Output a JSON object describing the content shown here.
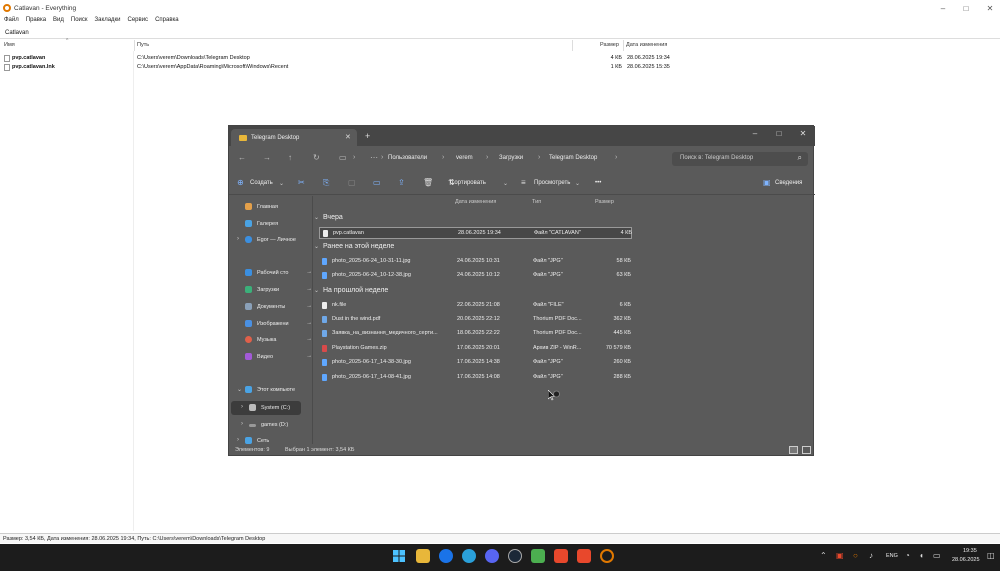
{
  "everything": {
    "title": "Catlavan - Everything",
    "menu": [
      "Файл",
      "Правка",
      "Вид",
      "Поиск",
      "Закладки",
      "Сервис",
      "Справка"
    ],
    "search_value": "Catlavan",
    "columns": {
      "name": "Имя",
      "path": "Путь",
      "size": "Размер",
      "date": "Дата изменения"
    },
    "results": [
      {
        "name": "pvp.catlavan",
        "path": "C:\\Users\\verem\\Downloads\\Telegram Desktop",
        "size": "4 КБ",
        "date": "28.06.2025 19:34"
      },
      {
        "name": "pvp.catlavan.lnk",
        "path": "C:\\Users\\verem\\AppData\\Roaming\\Microsoft\\Windows\\Recent",
        "size": "1 КБ",
        "date": "28.06.2025 15:35"
      }
    ],
    "status": "Размер: 3,54 КБ, Дата изменения: 28.06.2025 19:34, Путь: C:\\Users\\verem\\Downloads\\Telegram Desktop"
  },
  "explorer": {
    "tab_title": "Telegram Desktop",
    "breadcrumb": [
      "Пользователи",
      "verem",
      "Загрузки",
      "Telegram Desktop"
    ],
    "search_placeholder": "Поиск в: Telegram Desktop",
    "toolbar": {
      "create": "Создать",
      "sort": "Сортировать",
      "view": "Просмотреть",
      "details": "Сведения"
    },
    "nav": {
      "home": "Главная",
      "gallery": "Галерея",
      "egor": "Egor — Личное",
      "desktop": "Рабочий сто",
      "downloads": "Загрузки",
      "documents": "Документы",
      "images": "Изображени",
      "music": "Музыка",
      "video": "Видео",
      "this_pc": "Этот компьюте",
      "system": "System (C:)",
      "games": "games (D:)",
      "network": "Сеть"
    },
    "columns": {
      "date": "Дата изменения",
      "type": "Тип",
      "size": "Размер"
    },
    "groups": {
      "today": "Вчера",
      "earlier_week": "Ранее на этой неделе",
      "last_week": "На прошлой неделе"
    },
    "files_today": [
      {
        "name": "pvp.catlavan",
        "date": "28.06.2025 19:34",
        "type": "Файл \"CATLAVAN\"",
        "size": "4 КБ"
      }
    ],
    "files_week": [
      {
        "name": "photo_2025-06-24_10-31-11.jpg",
        "date": "24.06.2025 10:31",
        "type": "Файл \"JPG\"",
        "size": "58 КБ"
      },
      {
        "name": "photo_2025-06-24_10-12-38.jpg",
        "date": "24.06.2025 10:12",
        "type": "Файл \"JPG\"",
        "size": "63 КБ"
      }
    ],
    "files_last": [
      {
        "name": "nk.file",
        "date": "22.06.2025 21:08",
        "type": "Файл \"FILE\"",
        "size": "6 КБ"
      },
      {
        "name": "Dust in the wind.pdf",
        "date": "20.06.2025 22:12",
        "type": "Thorium PDF Doc...",
        "size": "362 КБ"
      },
      {
        "name": "Заявка_на_визнання_медичного_серти...",
        "date": "18.06.2025 22:22",
        "type": "Thorium PDF Doc...",
        "size": "445 КБ"
      },
      {
        "name": "Playstation Games.zip",
        "date": "17.06.2025 20:01",
        "type": "Архив ZIP - WinR...",
        "size": "70 579 КБ"
      },
      {
        "name": "photo_2025-06-17_14-38-30.jpg",
        "date": "17.06.2025 14:38",
        "type": "Файл \"JPG\"",
        "size": "260 КБ"
      },
      {
        "name": "photo_2025-06-17_14-08-41.jpg",
        "date": "17.06.2025 14:08",
        "type": "Файл \"JPG\"",
        "size": "288 КБ"
      }
    ],
    "status_count": "Элементов: 9",
    "status_selected": "Выбран 1 элемент: 3,54 КБ"
  },
  "taskbar": {
    "lang": "ENG",
    "time": "19:35",
    "date": "28.06.2025"
  }
}
